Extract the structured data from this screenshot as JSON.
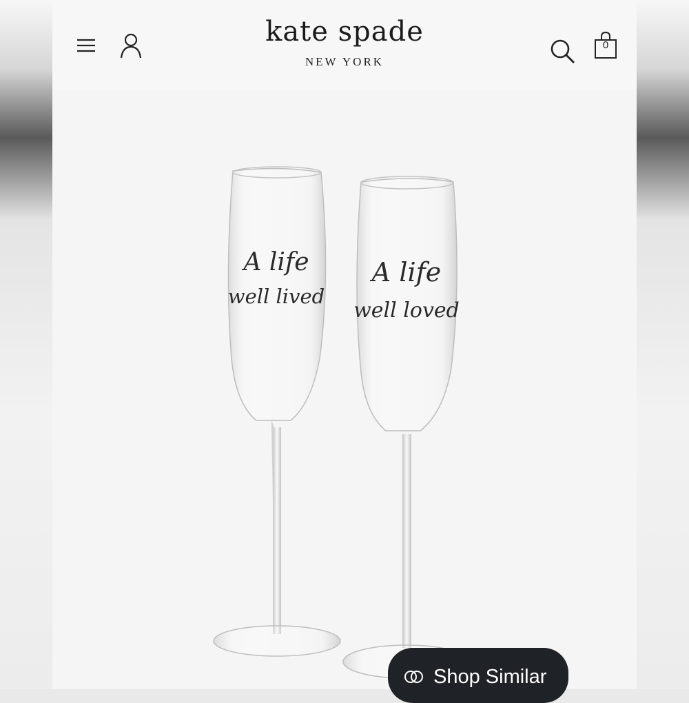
{
  "header": {
    "brand_name": "kate spade",
    "brand_city": "NEW YORK",
    "icons": {
      "menu": "hamburger-menu-icon",
      "account": "person-icon",
      "search": "magnifier-icon",
      "bag": "shopping-bag-icon"
    },
    "bag_count": "0"
  },
  "product": {
    "left_glass_text_line1": "A life",
    "left_glass_text_line2": "well lived",
    "right_glass_text_line1": "A life",
    "right_glass_text_line2": "well loved"
  },
  "shop_similar": {
    "label": "Shop Similar",
    "icon": "overlapping-circles-icon"
  },
  "colors": {
    "background": "#f5f5f5",
    "button_bg": "#1f2328",
    "button_text": "#ffffff"
  }
}
